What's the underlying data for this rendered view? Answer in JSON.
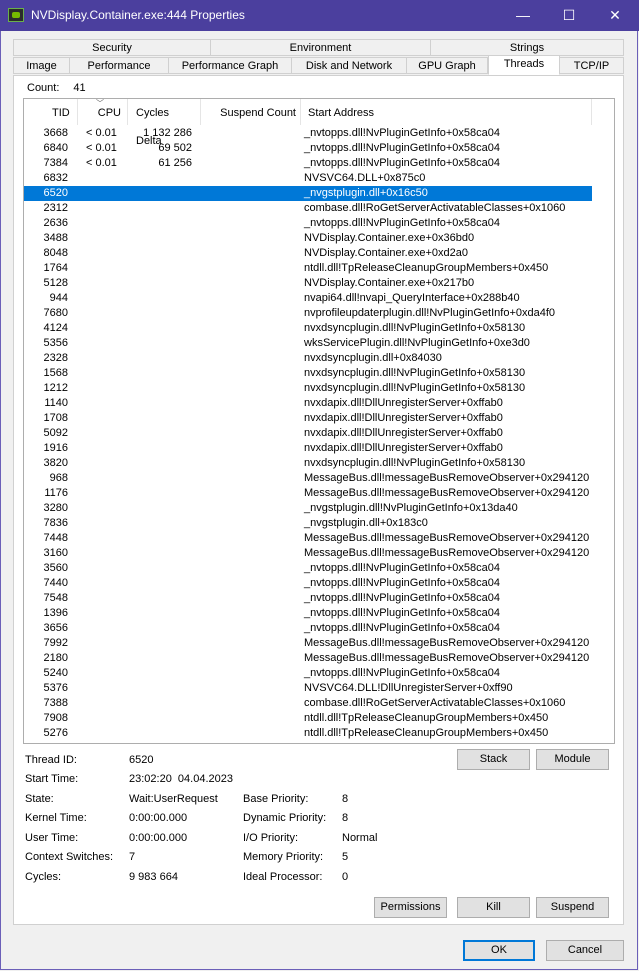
{
  "window": {
    "title": "NVDisplay.Container.exe:444 Properties",
    "min": "—",
    "max": "☐",
    "close": "✕"
  },
  "tabs": {
    "row1": [
      "Security",
      "Environment",
      "Strings"
    ],
    "row2": [
      "Image",
      "Performance",
      "Performance Graph",
      "Disk and Network",
      "GPU Graph",
      "Threads",
      "TCP/IP"
    ],
    "active": "Threads"
  },
  "count": {
    "label": "Count:",
    "value": "41"
  },
  "table": {
    "columns": [
      "TID",
      "CPU",
      "Cycles Delta",
      "Suspend Count",
      "Start Address"
    ],
    "rows": [
      [
        "3668",
        "< 0.01",
        "1 132 286",
        "",
        "_nvtopps.dll!NvPluginGetInfo+0x58ca04"
      ],
      [
        "6840",
        "< 0.01",
        "69 502",
        "",
        "_nvtopps.dll!NvPluginGetInfo+0x58ca04"
      ],
      [
        "7384",
        "< 0.01",
        "61 256",
        "",
        "_nvtopps.dll!NvPluginGetInfo+0x58ca04"
      ],
      [
        "6832",
        "",
        "",
        "",
        "NVSVC64.DLL+0x875c0"
      ],
      [
        "6520",
        "",
        "",
        "",
        "_nvgstplugin.dll+0x16c50"
      ],
      [
        "2312",
        "",
        "",
        "",
        "combase.dll!RoGetServerActivatableClasses+0x1060"
      ],
      [
        "2636",
        "",
        "",
        "",
        "_nvtopps.dll!NvPluginGetInfo+0x58ca04"
      ],
      [
        "3488",
        "",
        "",
        "",
        "NVDisplay.Container.exe+0x36bd0"
      ],
      [
        "8048",
        "",
        "",
        "",
        "NVDisplay.Container.exe+0xd2a0"
      ],
      [
        "1764",
        "",
        "",
        "",
        "ntdll.dll!TpReleaseCleanupGroupMembers+0x450"
      ],
      [
        "5128",
        "",
        "",
        "",
        "NVDisplay.Container.exe+0x217b0"
      ],
      [
        "944",
        "",
        "",
        "",
        "nvapi64.dll!nvapi_QueryInterface+0x288b40"
      ],
      [
        "7680",
        "",
        "",
        "",
        "nvprofileupdaterplugin.dll!NvPluginGetInfo+0xda4f0"
      ],
      [
        "4124",
        "",
        "",
        "",
        "nvxdsyncplugin.dll!NvPluginGetInfo+0x58130"
      ],
      [
        "5356",
        "",
        "",
        "",
        "wksServicePlugin.dll!NvPluginGetInfo+0xe3d0"
      ],
      [
        "2328",
        "",
        "",
        "",
        "nvxdsyncplugin.dll+0x84030"
      ],
      [
        "1568",
        "",
        "",
        "",
        "nvxdsyncplugin.dll!NvPluginGetInfo+0x58130"
      ],
      [
        "1212",
        "",
        "",
        "",
        "nvxdsyncplugin.dll!NvPluginGetInfo+0x58130"
      ],
      [
        "1140",
        "",
        "",
        "",
        "nvxdapix.dll!DllUnregisterServer+0xffab0"
      ],
      [
        "1708",
        "",
        "",
        "",
        "nvxdapix.dll!DllUnregisterServer+0xffab0"
      ],
      [
        "5092",
        "",
        "",
        "",
        "nvxdapix.dll!DllUnregisterServer+0xffab0"
      ],
      [
        "1916",
        "",
        "",
        "",
        "nvxdapix.dll!DllUnregisterServer+0xffab0"
      ],
      [
        "3820",
        "",
        "",
        "",
        "nvxdsyncplugin.dll!NvPluginGetInfo+0x58130"
      ],
      [
        "968",
        "",
        "",
        "",
        "MessageBus.dll!messageBusRemoveObserver+0x294120"
      ],
      [
        "1176",
        "",
        "",
        "",
        "MessageBus.dll!messageBusRemoveObserver+0x294120"
      ],
      [
        "3280",
        "",
        "",
        "",
        "_nvgstplugin.dll!NvPluginGetInfo+0x13da40"
      ],
      [
        "7836",
        "",
        "",
        "",
        "_nvgstplugin.dll+0x183c0"
      ],
      [
        "7448",
        "",
        "",
        "",
        "MessageBus.dll!messageBusRemoveObserver+0x294120"
      ],
      [
        "3160",
        "",
        "",
        "",
        "MessageBus.dll!messageBusRemoveObserver+0x294120"
      ],
      [
        "3560",
        "",
        "",
        "",
        "_nvtopps.dll!NvPluginGetInfo+0x58ca04"
      ],
      [
        "7440",
        "",
        "",
        "",
        "_nvtopps.dll!NvPluginGetInfo+0x58ca04"
      ],
      [
        "7548",
        "",
        "",
        "",
        "_nvtopps.dll!NvPluginGetInfo+0x58ca04"
      ],
      [
        "1396",
        "",
        "",
        "",
        "_nvtopps.dll!NvPluginGetInfo+0x58ca04"
      ],
      [
        "3656",
        "",
        "",
        "",
        "_nvtopps.dll!NvPluginGetInfo+0x58ca04"
      ],
      [
        "7992",
        "",
        "",
        "",
        "MessageBus.dll!messageBusRemoveObserver+0x294120"
      ],
      [
        "2180",
        "",
        "",
        "",
        "MessageBus.dll!messageBusRemoveObserver+0x294120"
      ],
      [
        "5240",
        "",
        "",
        "",
        "_nvtopps.dll!NvPluginGetInfo+0x58ca04"
      ],
      [
        "5376",
        "",
        "",
        "",
        "NVSVC64.DLL!DllUnregisterServer+0xff90"
      ],
      [
        "7388",
        "",
        "",
        "",
        "combase.dll!RoGetServerActivatableClasses+0x1060"
      ],
      [
        "7908",
        "",
        "",
        "",
        "ntdll.dll!TpReleaseCleanupGroupMembers+0x450"
      ],
      [
        "5276",
        "",
        "",
        "",
        "ntdll.dll!TpReleaseCleanupGroupMembers+0x450"
      ]
    ],
    "selected_tid": "6520"
  },
  "details": {
    "thread_id_label": "Thread ID:",
    "thread_id": "6520",
    "start_time_label": "Start Time:",
    "start_time": "23:02:20  04.04.2023",
    "state_label": "State:",
    "state": "Wait:UserRequest",
    "kernel_label": "Kernel Time:",
    "kernel": "0:00:00.000",
    "user_label": "User Time:",
    "user": "0:00:00.000",
    "ctx_label": "Context Switches:",
    "ctx": "7",
    "cycles_label": "Cycles:",
    "cycles": "9 983 664",
    "base_label": "Base Priority:",
    "base": "8",
    "dyn_label": "Dynamic Priority:",
    "dyn": "8",
    "io_label": "I/O Priority:",
    "io": "Normal",
    "mem_label": "Memory Priority:",
    "mem": "5",
    "ideal_label": "Ideal Processor:",
    "ideal": "0"
  },
  "buttons": {
    "stack": "Stack",
    "module": "Module",
    "permissions": "Permissions",
    "kill": "Kill",
    "suspend": "Suspend",
    "ok": "OK",
    "cancel": "Cancel"
  },
  "colors": {
    "titlebar": "#4b3f9e",
    "selection": "#0078d7",
    "accent_icon": "#76b900"
  }
}
